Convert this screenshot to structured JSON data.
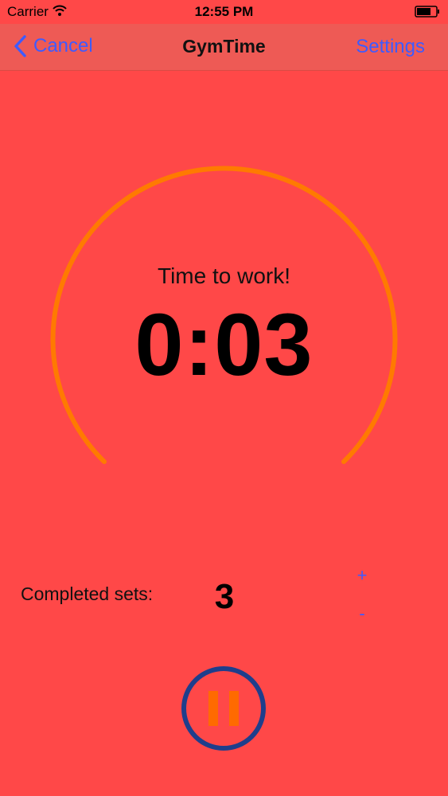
{
  "status_bar": {
    "carrier": "Carrier",
    "time": "12:55 PM"
  },
  "nav": {
    "back_label": "Cancel",
    "title": "GymTime",
    "settings_label": "Settings"
  },
  "timer": {
    "phase_label": "Time to work!",
    "value": "0:03"
  },
  "sets": {
    "label": "Completed sets:",
    "value": "3",
    "increment_label": "+",
    "decrement_label": "-"
  },
  "colors": {
    "background": "#FF4848",
    "nav_background": "#EE5A55",
    "accent": "#3E5BFF",
    "arc": "#FF7A00",
    "pause_ring": "#1F3E8C",
    "pause_bars": "#FF6A00"
  },
  "icons": {
    "back": "chevron-left-icon",
    "wifi": "wifi-icon",
    "battery": "battery-icon",
    "pause": "pause-icon"
  }
}
